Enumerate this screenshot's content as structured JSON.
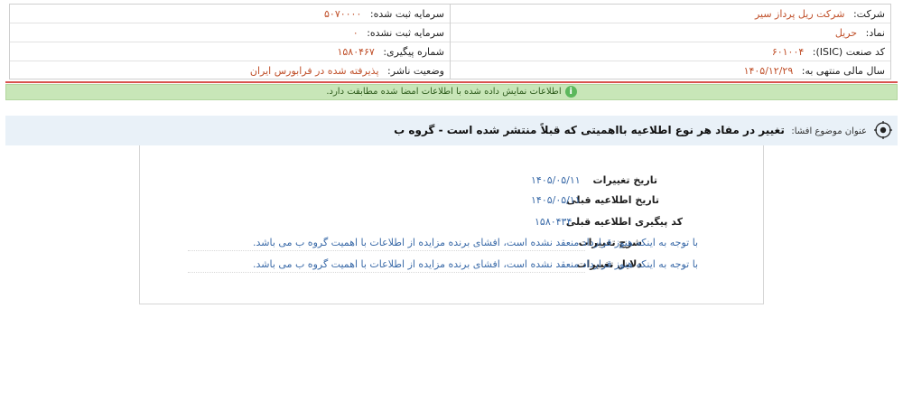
{
  "info": {
    "company_label": "شرکت:",
    "company_value": "شرکت ریل پرداز سیر",
    "symbol_label": "نماد:",
    "symbol_value": "حریل",
    "isic_label": "کد صنعت (ISIC):",
    "isic_value": "۶۰۱۰۰۴",
    "fiscal_label": "سال مالی منتهی به:",
    "fiscal_value": "۱۴۰۵/۱۲/۲۹",
    "reg_capital_label": "سرمایه ثبت شده:",
    "reg_capital_value": "۵۰۷۰۰۰۰",
    "unreg_capital_label": "سرمایه ثبت نشده:",
    "unreg_capital_value": "۰",
    "tracking_label": "شماره پیگیری:",
    "tracking_value": "۱۵۸۰۴۶۷",
    "status_label": "وضعیت ناشر:",
    "status_value": "پذیرفته شده در فرابورس ایران"
  },
  "banner": {
    "icon": "info-icon",
    "text": "اطلاعات نمایش داده شده با اطلاعات امضا شده مطابقت دارد."
  },
  "subject": {
    "label": "عنوان موضوع افشا:",
    "value": "تغییر در مفاد هر نوع اطلاعیه بااهمیتی که قبلاً منتشر شده است - گروه ب"
  },
  "details": {
    "change_date_label": "تاریخ تغییرات",
    "change_date_value": "۱۴۰۵/۰۵/۱۱",
    "prev_date_label": "تاریخ اطلاعیه قبلی",
    "prev_date_value": "۱۴۰۵/۰۵/۱۱",
    "prev_tracking_label": "کد پیگیری اطلاعیه قبلی",
    "prev_tracking_value": "۱۵۸۰۴۳۴",
    "desc_label": "شرح تغییرات",
    "desc_value": "با توجه به اینکه هنوز قرارداد منعقد نشده است، افشای برنده مزایده از اطلاعات با اهمیت گروه ب می باشد.",
    "reason_label": "دلایل تغییرات",
    "reason_value": "با توجه به اینکه هنوز قرارداد منعقد نشده است، افشای برنده مزایده از اطلاعات با اهمیت گروه ب می باشد."
  },
  "colors": {
    "value_orange": "#c0502a",
    "value_blue": "#3a6aa8",
    "banner_green": "#c8e6b8",
    "subject_bg": "#e9f1f8",
    "accent_red": "#d9534f"
  }
}
